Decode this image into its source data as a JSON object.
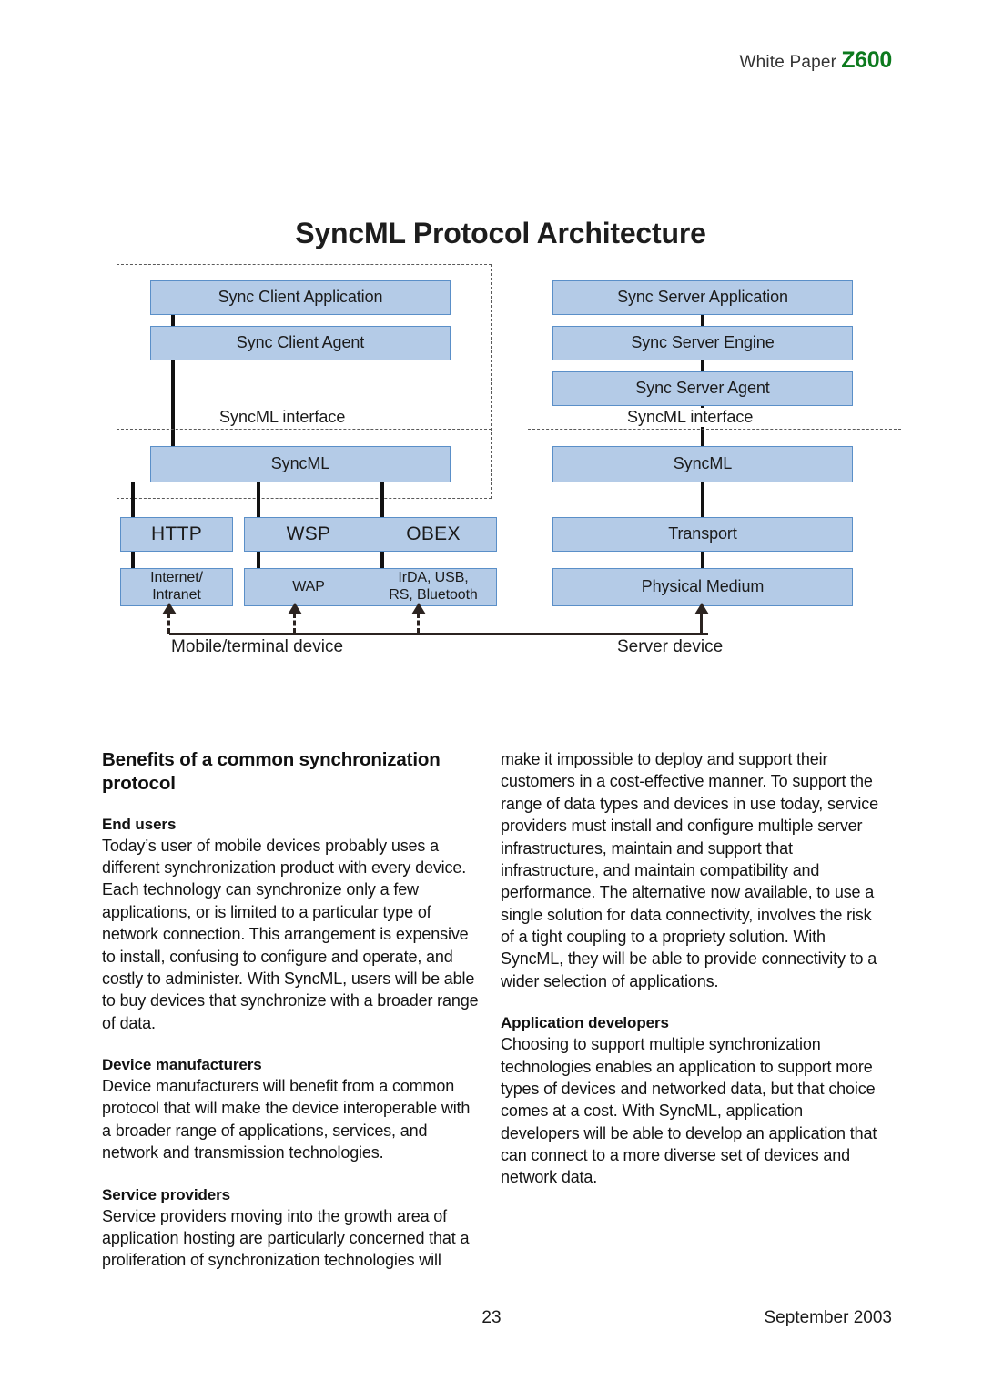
{
  "header": {
    "white_paper_label": "White Paper",
    "model": "Z600",
    "model_color": "#0d7a1e"
  },
  "figure": {
    "title": "SyncML Protocol Architecture",
    "box_fill": "#b4cbe7",
    "box_border": "#5a8fc8",
    "client_boxes": {
      "app": "Sync Client Application",
      "agent": "Sync Client Agent",
      "syncml": "SyncML"
    },
    "client_interface_label": "SyncML interface",
    "client_transports": [
      "HTTP",
      "WSP",
      "OBEX"
    ],
    "client_bearers": [
      "Internet/\nIntranet",
      "WAP",
      "IrDA, USB,\nRS, Bluetooth"
    ],
    "client_bearer_lines": [
      [
        "Internet/",
        "Intranet"
      ],
      [
        "WAP"
      ],
      [
        "IrDA, USB,",
        "RS, Bluetooth"
      ]
    ],
    "server_boxes": {
      "app": "Sync Server Application",
      "engine": "Sync Server Engine",
      "agent": "Sync Server Agent",
      "syncml": "SyncML",
      "transport": "Transport",
      "physical": "Physical Medium"
    },
    "server_interface_label": "SyncML interface",
    "device_labels": {
      "mobile": "Mobile/terminal device",
      "server": "Server device"
    }
  },
  "content": {
    "section_title": "Benefits of a common synchronization protocol",
    "left": {
      "end_users_heading": "End users",
      "end_users_body": "Today’s user of mobile devices probably uses a different synchronization product with every device. Each technology can synchronize only a few applications, or is limited to a particular type of network connection. This arrangement is expensive to install, confusing to configure and operate, and costly to administer. With SyncML, users will be able to buy devices that synchronize with a broader range of data.",
      "device_manufacturers_heading": "Device manufacturers",
      "device_manufacturers_body": "Device manufacturers will benefit from a common protocol that will make the device interoperable with a broader range of applications, services, and network and transmission technologies.",
      "service_providers_heading": "Service providers",
      "service_providers_body": "Service providers moving into the growth area of application hosting are particularly concerned that a proliferation of synchronization technologies will"
    },
    "right": {
      "service_providers_continued": "make it impossible to deploy and support their customers in a cost-effective manner. To support the range of data types and devices in use today, service providers must install and configure multiple server infrastructures, maintain and support that infrastructure, and maintain compatibility and performance. The alternative now available, to use a single solution for data connectivity, involves the risk of a tight coupling to a propriety solution. With SyncML, they will be able to provide connectivity to a wider selection of applications.",
      "application_developers_heading": "Application developers",
      "application_developers_body": "Choosing to support multiple synchronization technologies enables an application to support more types of devices and networked data, but that choice comes at a cost. With SyncML, application developers will be able to develop an application that can connect to a more diverse set of devices and network data."
    }
  },
  "footer": {
    "page_number": "23",
    "date": "September 2003"
  }
}
